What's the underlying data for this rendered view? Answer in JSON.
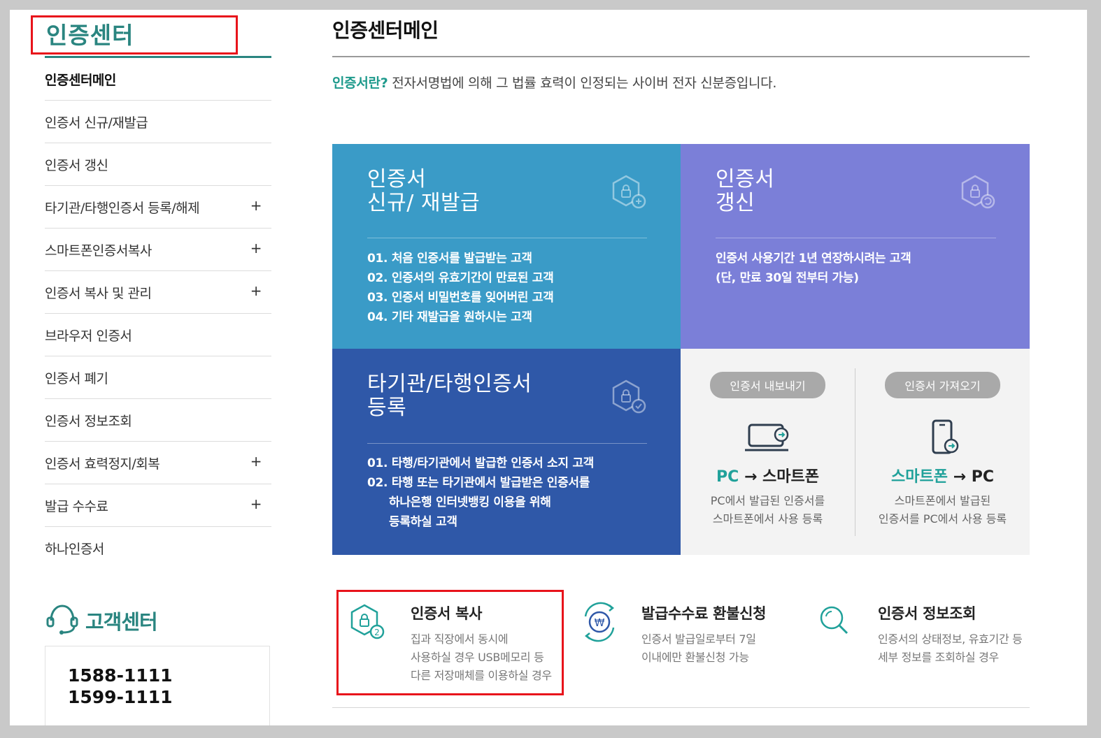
{
  "sidebar": {
    "title": "인증센터",
    "menu": [
      {
        "label": "인증센터메인",
        "active": true,
        "expandable": false
      },
      {
        "label": "인증서 신규/재발급",
        "active": false,
        "expandable": false
      },
      {
        "label": "인증서 갱신",
        "active": false,
        "expandable": false
      },
      {
        "label": "타기관/타행인증서 등록/해제",
        "active": false,
        "expandable": true
      },
      {
        "label": "스마트폰인증서복사",
        "active": false,
        "expandable": true
      },
      {
        "label": "인증서 복사 및 관리",
        "active": false,
        "expandable": true
      },
      {
        "label": "브라우저 인증서",
        "active": false,
        "expandable": false
      },
      {
        "label": "인증서 폐기",
        "active": false,
        "expandable": false
      },
      {
        "label": "인증서 정보조회",
        "active": false,
        "expandable": false
      },
      {
        "label": "인증서 효력정지/회복",
        "active": false,
        "expandable": true
      },
      {
        "label": "발급 수수료",
        "active": false,
        "expandable": true
      },
      {
        "label": "하나인증서",
        "active": false,
        "expandable": false
      }
    ],
    "expand_symbol": "+",
    "customer_center": {
      "title": "고객센터",
      "phones": [
        "1588-1111",
        "1599-1111"
      ]
    }
  },
  "main": {
    "page_title": "인증센터메인",
    "intro": {
      "accent": "인증서란?",
      "text": " 전자서명법에 의해 그 법률 효력이 인정되는 사이버 전자 신분증입니다."
    },
    "cards": {
      "new": {
        "title_line1": "인증서",
        "title_line2": "신규/ 재발급",
        "items": [
          "01. 처음 인증서를 발급받는 고객",
          "02. 인증서의 유효기간이 만료된 고객",
          "03. 인증서 비밀번호를 잊어버린 고객",
          "04. 기타 재발급을 원하시는 고객"
        ]
      },
      "renew": {
        "title_line1": "인증서",
        "title_line2": "갱신",
        "items": [
          "인증서 사용기간 1년 연장하시려는 고객",
          "(단, 만료 30일 전부터 가능)"
        ]
      },
      "other": {
        "title_line1": "타기관/타행인증서",
        "title_line2": "등록",
        "items": [
          "01. 타행/타기관에서 발급한 인증서 소지 고객",
          "02. 타행 또는 타기관에서 발급받은 인증서를",
          "하나은행 인터넷뱅킹 이용을 위해",
          "등록하실 고객"
        ]
      },
      "copy": {
        "export": {
          "pill": "인증서 내보내기",
          "from": "PC",
          "arrow": "→",
          "to": "스마트폰",
          "desc_line1": "PC에서 발급된 인증서를",
          "desc_line2": "스마트폰에서 사용 등록"
        },
        "import": {
          "pill": "인증서 가져오기",
          "from": "스마트폰",
          "arrow": "→",
          "to": "PC",
          "desc_line1": "스마트폰에서 발급된",
          "desc_line2": "인증서를 PC에서 사용 등록"
        }
      }
    },
    "services": [
      {
        "title": "인증서 복사",
        "desc": [
          "집과 직장에서 동시에",
          "사용하실 경우 USB메모리 등",
          "다른 저장매체를 이용하실 경우"
        ],
        "icon": "certificate-copy-icon"
      },
      {
        "title": "발급수수료 환불신청",
        "desc": [
          "인증서 발급일로부터 7일",
          "이내에만 환불신청 가능"
        ],
        "icon": "won-refund-icon"
      },
      {
        "title": "인증서 정보조회",
        "desc": [
          "인증서의 상태정보, 유효기간 등",
          "세부 정보를 조회하실 경우"
        ],
        "icon": "search-icon"
      }
    ]
  },
  "colors": {
    "brand_teal": "#2a8580",
    "accent_green": "#1e9a8c",
    "card_new": "#3a9bc7",
    "card_renew": "#7b7fd8",
    "card_other": "#2f58a8",
    "card_copy": "#f3f3f3",
    "highlight_red": "#e8141b"
  }
}
